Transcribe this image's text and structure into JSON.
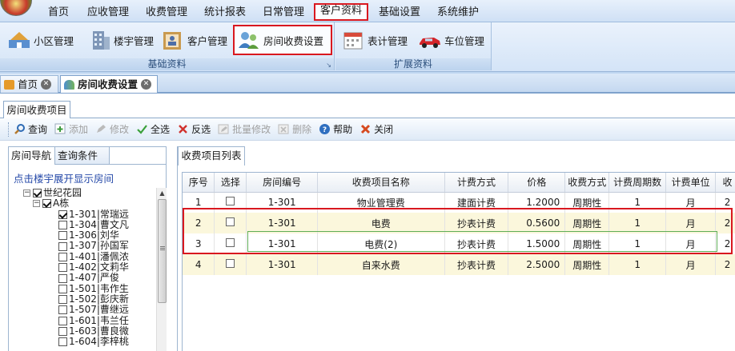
{
  "menubar": {
    "items": [
      "首页",
      "应收管理",
      "收费管理",
      "统计报表",
      "日常管理",
      "客户资料",
      "基础设置",
      "系统维护"
    ],
    "active_index": 5
  },
  "ribbon": {
    "groups": [
      {
        "title": "基础资料",
        "buttons": [
          "小区管理",
          "楼宇管理",
          "客户管理",
          "房间收费设置"
        ]
      },
      {
        "title": "扩展资料",
        "buttons": [
          "表计管理",
          "车位管理"
        ]
      }
    ]
  },
  "doc_tabs": [
    "首页",
    "房间收费设置"
  ],
  "sub_tab": "房间收费项目",
  "toolbar": {
    "items": [
      {
        "label": "查询",
        "enabled": true,
        "icon": "search-icon"
      },
      {
        "label": "添加",
        "enabled": false,
        "icon": "add-icon"
      },
      {
        "label": "修改",
        "enabled": false,
        "icon": "edit-icon"
      },
      {
        "label": "全选",
        "enabled": true,
        "icon": "checkmark-icon"
      },
      {
        "label": "反选",
        "enabled": true,
        "icon": "invert-icon"
      },
      {
        "label": "批量修改",
        "enabled": false,
        "icon": "batch-edit-icon"
      },
      {
        "label": "删除",
        "enabled": false,
        "icon": "delete-icon"
      },
      {
        "label": "帮助",
        "enabled": true,
        "icon": "help-icon"
      },
      {
        "label": "关闭",
        "enabled": true,
        "icon": "close-icon"
      }
    ]
  },
  "left_panel": {
    "tabs": [
      "房间导航",
      "查询条件"
    ],
    "hint": "点击楼宇展开显示房间",
    "tree": [
      {
        "label": "世纪花园",
        "level": 0,
        "checked": true,
        "expander": "−"
      },
      {
        "label": "A栋",
        "level": 1,
        "checked": true,
        "expander": "−"
      },
      {
        "label": "1-301|常瑞远",
        "level": 2,
        "checked": true
      },
      {
        "label": "1-304|曹文凡",
        "level": 2,
        "checked": false
      },
      {
        "label": "1-306|刘华",
        "level": 2,
        "checked": false
      },
      {
        "label": "1-307|孙国军",
        "level": 2,
        "checked": false
      },
      {
        "label": "1-401|潘佩浓",
        "level": 2,
        "checked": false
      },
      {
        "label": "1-402|文莉华",
        "level": 2,
        "checked": false
      },
      {
        "label": "1-407|严俊",
        "level": 2,
        "checked": false
      },
      {
        "label": "1-501|韦作生",
        "level": 2,
        "checked": false
      },
      {
        "label": "1-502|彭庆新",
        "level": 2,
        "checked": false
      },
      {
        "label": "1-507|曹继远",
        "level": 2,
        "checked": false
      },
      {
        "label": "1-601|韦兰任",
        "level": 2,
        "checked": false
      },
      {
        "label": "1-603|曹良微",
        "level": 2,
        "checked": false
      },
      {
        "label": "1-604|李梓桃",
        "level": 2,
        "checked": false
      }
    ]
  },
  "right_panel": {
    "tab": "收费项目列表",
    "columns": [
      "序号",
      "选择",
      "房间编号",
      "收费项目名称",
      "计费方式",
      "价格",
      "收费方式",
      "计费周期数",
      "计费单位",
      "收"
    ],
    "rows": [
      [
        "1",
        "",
        "1-301",
        "物业管理费",
        "建面计费",
        "1.2000",
        "周期性",
        "1",
        "月",
        "2"
      ],
      [
        "2",
        "",
        "1-301",
        "电费",
        "抄表计费",
        "0.5600",
        "周期性",
        "1",
        "月",
        "2"
      ],
      [
        "3",
        "",
        "1-301",
        "电费(2)",
        "抄表计费",
        "1.5000",
        "周期性",
        "1",
        "月",
        "2"
      ],
      [
        "4",
        "",
        "1-301",
        "自来水费",
        "抄表计费",
        "2.5000",
        "周期性",
        "1",
        "月",
        "2"
      ]
    ]
  },
  "colors": {
    "highlight_red": "#d9181f",
    "selection_green": "#5fae57",
    "row_alt": "#fbf7dc"
  }
}
